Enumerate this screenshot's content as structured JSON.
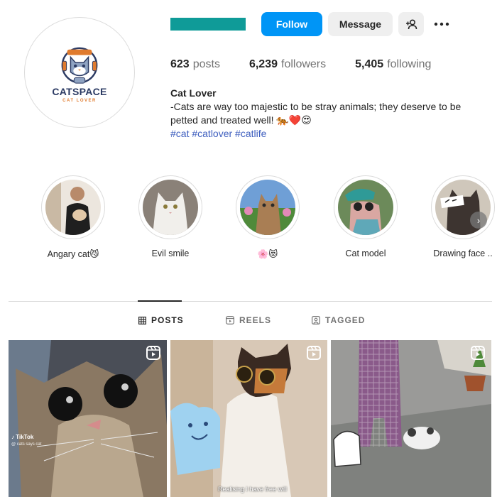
{
  "profile": {
    "logo_title": "CATSPACE",
    "logo_subtitle": "CAT LOVER",
    "username_redacted_color": "#0f9b98"
  },
  "actions": {
    "follow_label": "Follow",
    "message_label": "Message",
    "suggest_icon": "person-add-icon",
    "more_icon": "more-horizontal-icon"
  },
  "stats": {
    "posts_count": "623",
    "posts_label": "posts",
    "followers_count": "6,239",
    "followers_label": "followers",
    "following_count": "5,405",
    "following_label": "following"
  },
  "bio": {
    "name": "Cat Lover",
    "line1": "-Cats are way too majestic to be stray animals; they deserve to be",
    "line2": "petted and treated well! 🐅❤️😍",
    "hashtags": "#cat #catlover #catlife"
  },
  "highlights": [
    {
      "label": "Angary cat😼"
    },
    {
      "label": "Evil smile"
    },
    {
      "label": "🌸😻"
    },
    {
      "label": "Cat model"
    },
    {
      "label": "Drawing face .."
    }
  ],
  "tabs": {
    "posts": "POSTS",
    "reels": "REELS",
    "tagged": "TAGGED",
    "active": "POSTS"
  },
  "posts": {
    "post1_watermark": "TikTok",
    "post1_watermark_sub": "@ cats says cat",
    "post2_caption": "Realising I have free will"
  },
  "colors": {
    "accent": "#0095f6",
    "hashtag": "#3f5fbf",
    "secondary_text": "#737373",
    "border": "#dbdbdb"
  }
}
